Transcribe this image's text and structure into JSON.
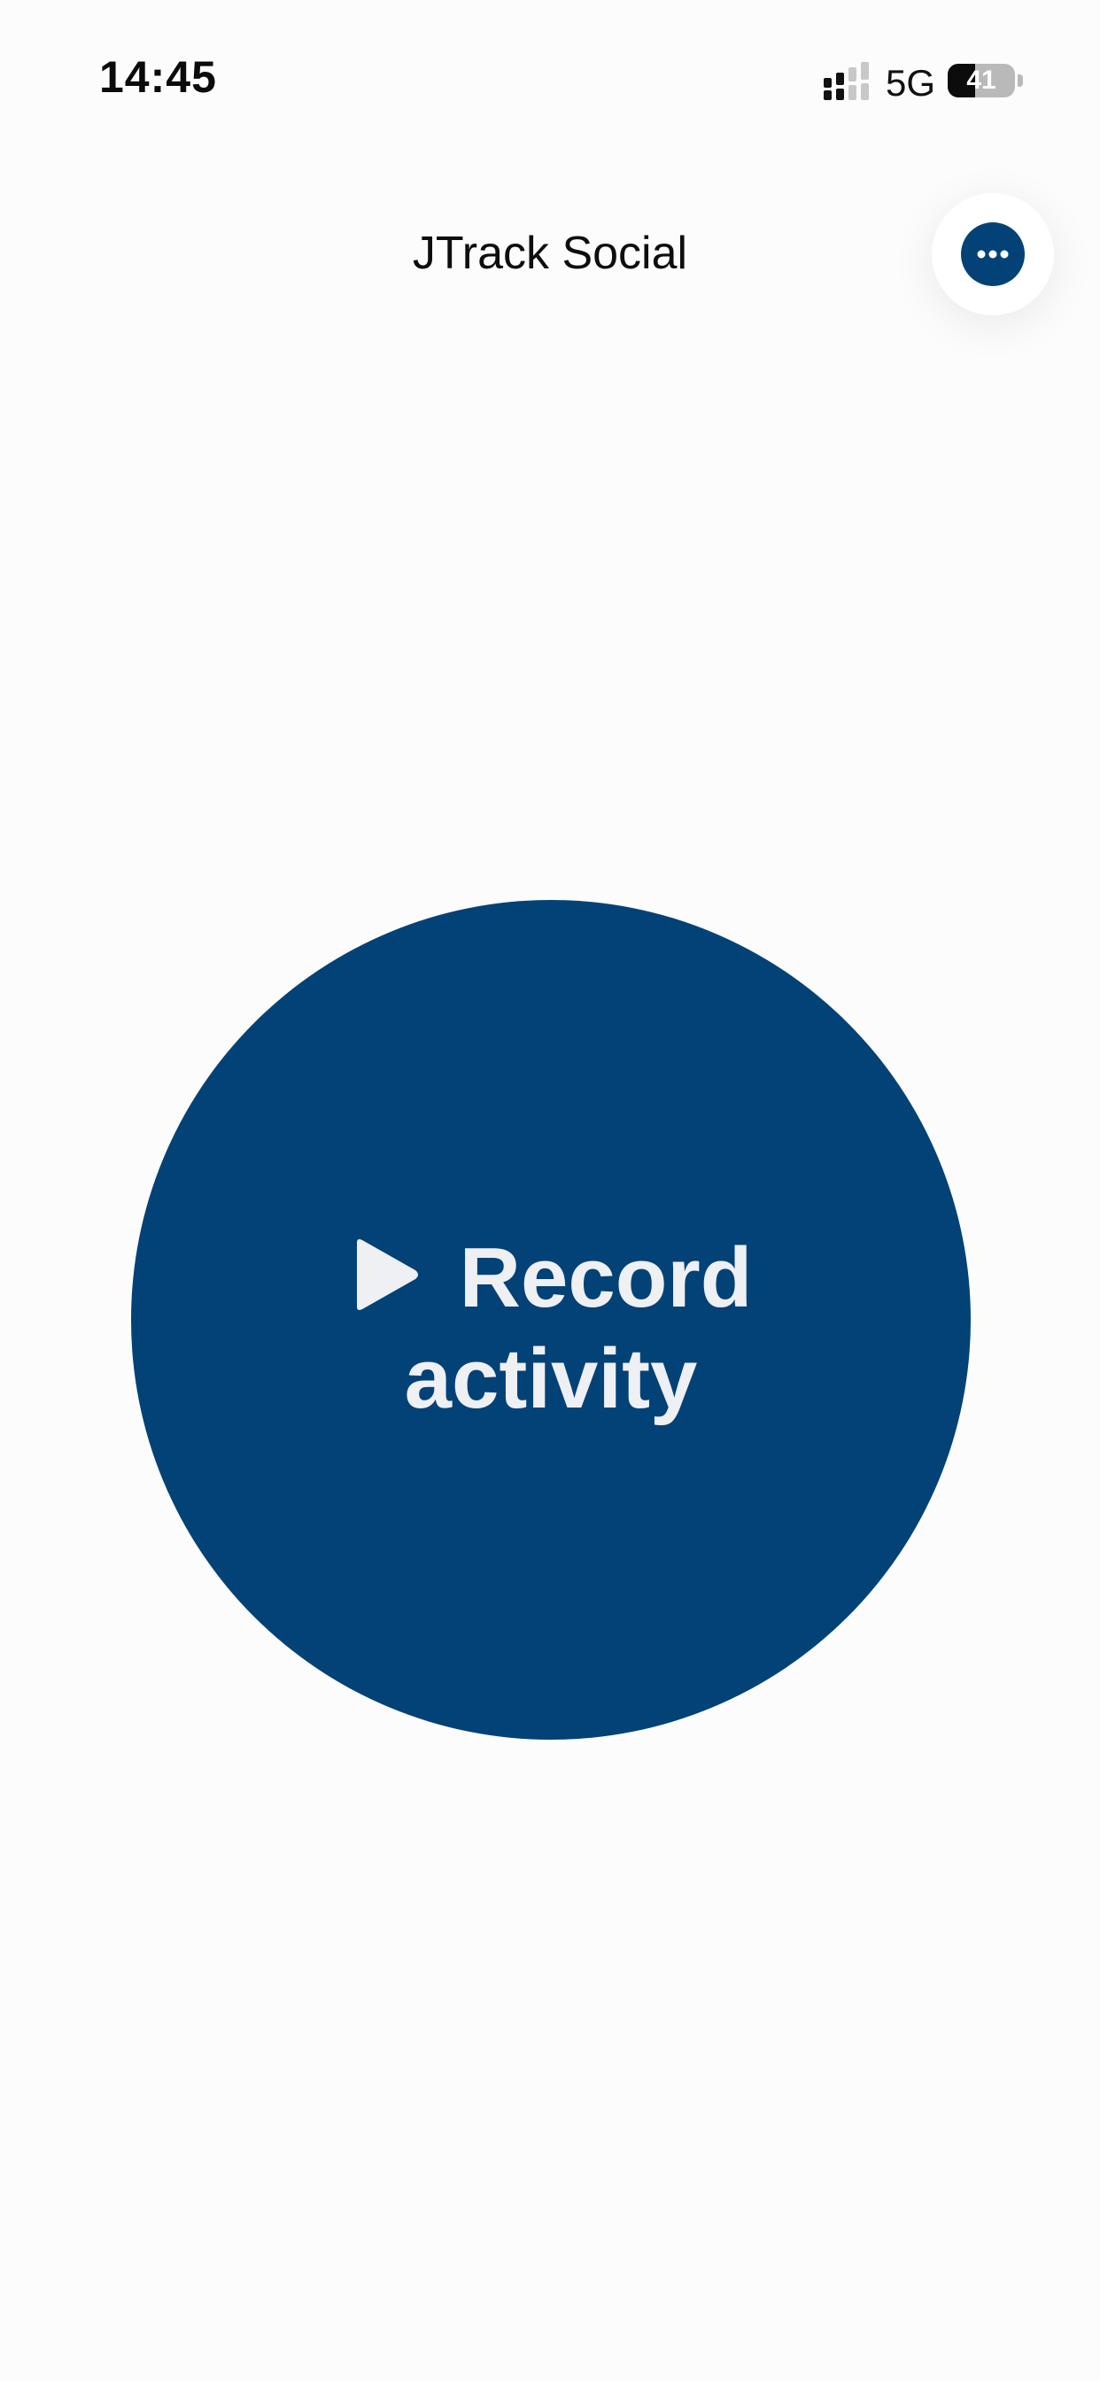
{
  "status_bar": {
    "time": "14:45",
    "network": "5G",
    "battery_level": "41",
    "battery_fraction": 0.41,
    "signal_icon": "signal-bars-icon",
    "battery_icon": "battery-icon"
  },
  "header": {
    "title": "JTrack Social",
    "more_icon": "more-horizontal-icon"
  },
  "record_button": {
    "line1": "Record",
    "line2": "activity",
    "icon": "play-icon"
  },
  "colors": {
    "accent": "#034277",
    "background": "#fcfcfc",
    "button_text": "#eef0f3"
  }
}
